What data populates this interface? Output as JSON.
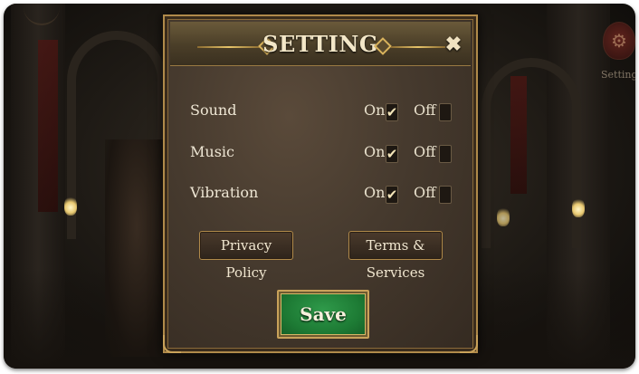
{
  "dialog": {
    "title": "SETTING",
    "close_label": "✖"
  },
  "settings": [
    {
      "label": "Sound",
      "on_label": "On",
      "off_label": "Off",
      "on_checked": true,
      "off_checked": false
    },
    {
      "label": "Music",
      "on_label": "On",
      "off_label": "Off",
      "on_checked": true,
      "off_checked": false
    },
    {
      "label": "Vibration",
      "on_label": "On",
      "off_label": "Off",
      "on_checked": true,
      "off_checked": false
    }
  ],
  "buttons": {
    "privacy": "Privacy Policy",
    "terms": "Terms & Services",
    "save": "Save"
  },
  "hud": {
    "setting_label": "Setting",
    "gear_icon": "⚙"
  },
  "check_glyph": "✔",
  "colors": {
    "gold_border": "#b08a4a",
    "save_green": "#1d7a34"
  }
}
